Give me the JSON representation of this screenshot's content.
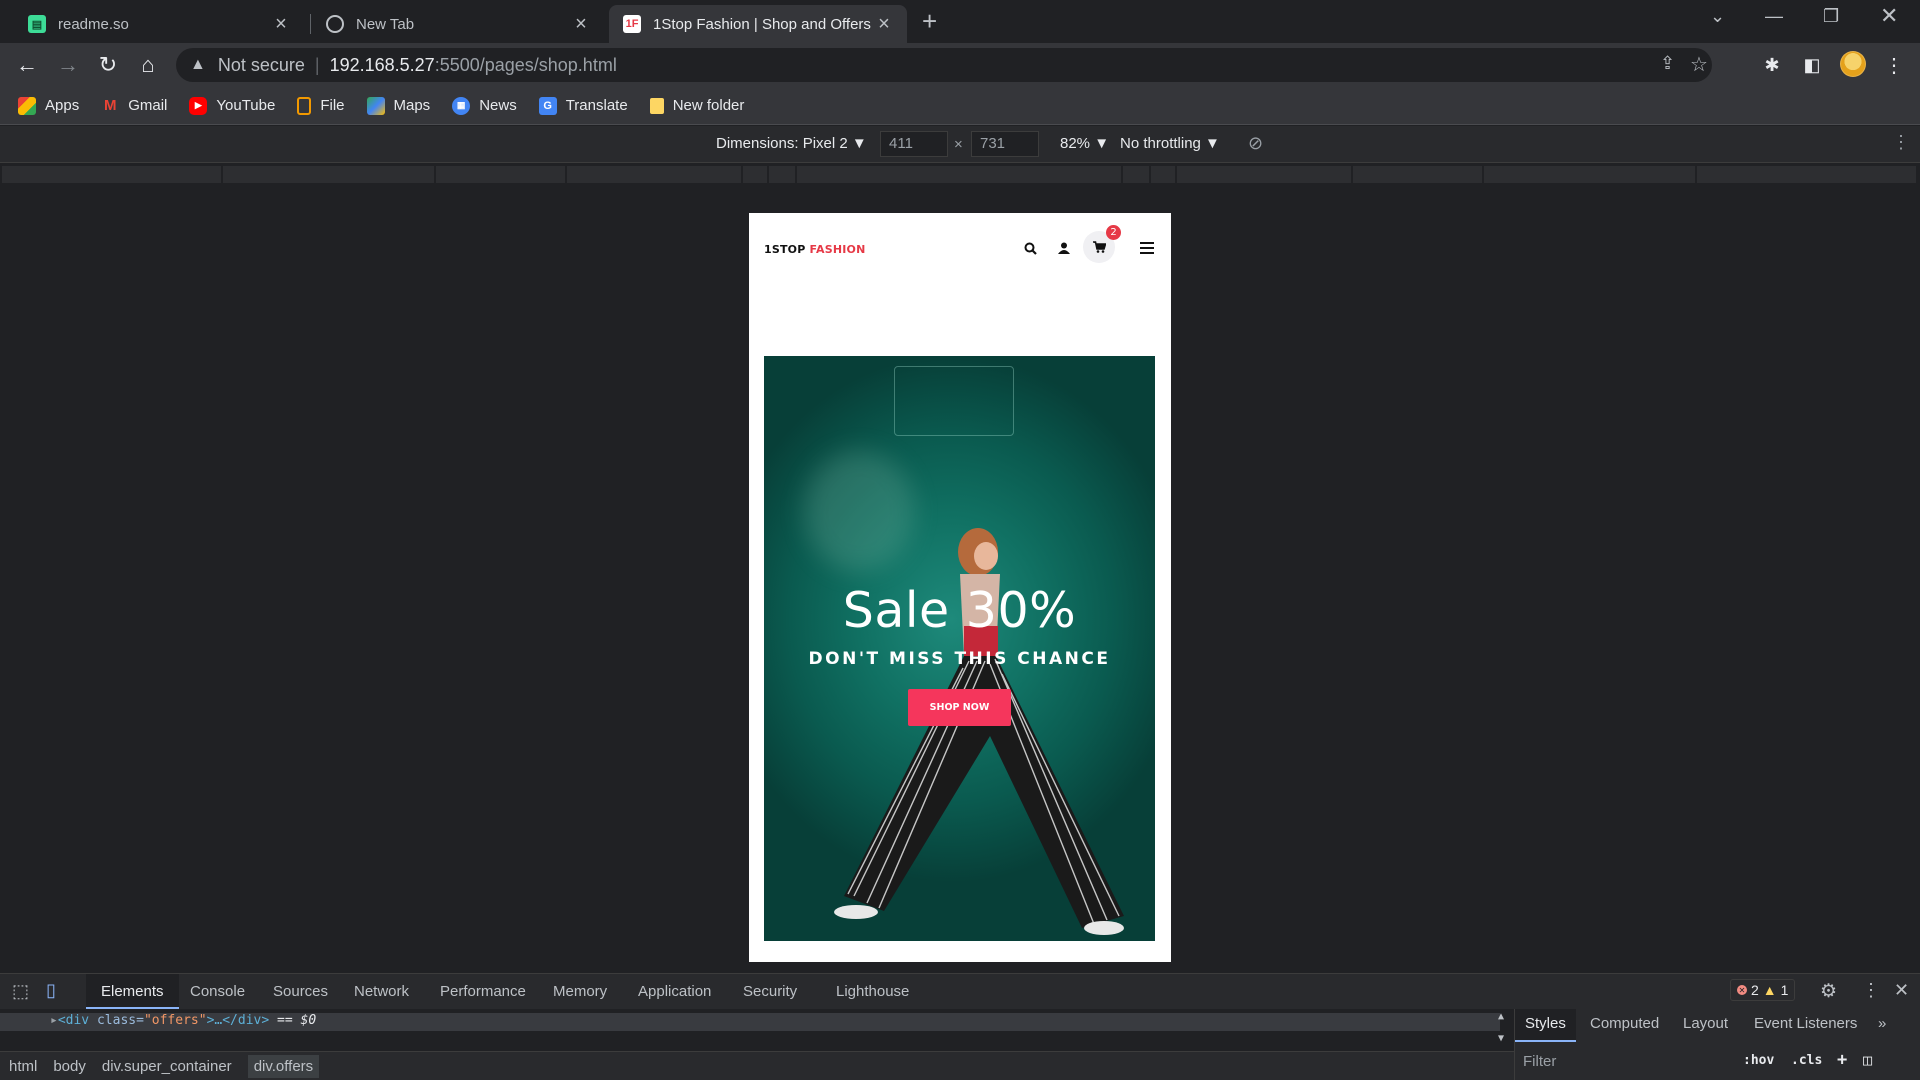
{
  "browser": {
    "tabs": [
      {
        "title": "readme.so",
        "icon": "readme-icon"
      },
      {
        "title": "New Tab",
        "icon": "globe-icon"
      },
      {
        "title": "1Stop Fashion | Shop and Offers",
        "icon": "1stop-icon"
      }
    ],
    "address": {
      "security": "Not secure",
      "host": "192.168.5.27",
      "path": ":5500/pages/shop.html"
    },
    "bookmarks": [
      {
        "label": "Apps",
        "icon": "apps-grid-icon"
      },
      {
        "label": "Gmail",
        "icon": "gmail-icon"
      },
      {
        "label": "YouTube",
        "icon": "youtube-icon"
      },
      {
        "label": "File",
        "icon": "file-icon"
      },
      {
        "label": "Maps",
        "icon": "maps-icon"
      },
      {
        "label": "News",
        "icon": "news-icon"
      },
      {
        "label": "Translate",
        "icon": "translate-icon"
      },
      {
        "label": "New folder",
        "icon": "folder-icon"
      }
    ]
  },
  "device_toolbar": {
    "dimensions": "Dimensions: Pixel 2 ▼",
    "width": "411",
    "times": "×",
    "height": "731",
    "zoom": "82% ▼",
    "throttling": "No throttling ▼"
  },
  "site": {
    "logo_part1": "1STOP ",
    "logo_part2": "FASHION",
    "cart_count": "2",
    "hero": {
      "title": "Sale 30%",
      "subtitle": "DON'T MISS THIS CHANCE",
      "button": "SHOP NOW"
    }
  },
  "devtools": {
    "tabs": [
      "Elements",
      "Console",
      "Sources",
      "Network",
      "Performance",
      "Memory",
      "Application",
      "Security",
      "Lighthouse"
    ],
    "errors": "2",
    "warnings": "1",
    "dom_line": {
      "open": "<div",
      "attr": " class=",
      "value": "\"offers\"",
      "rest": ">…</div>",
      "sel": " == $0"
    },
    "breadcrumbs": [
      "html",
      "body",
      "div.super_container",
      "div.offers"
    ],
    "side_tabs": [
      "Styles",
      "Computed",
      "Layout",
      "Event Listeners"
    ],
    "filter_placeholder": "Filter",
    "hov": ":hov",
    "cls": ".cls"
  },
  "colors": {
    "accent_red": "#e63946",
    "button_pink": "#f5365c",
    "hero_teal": "#107062"
  }
}
